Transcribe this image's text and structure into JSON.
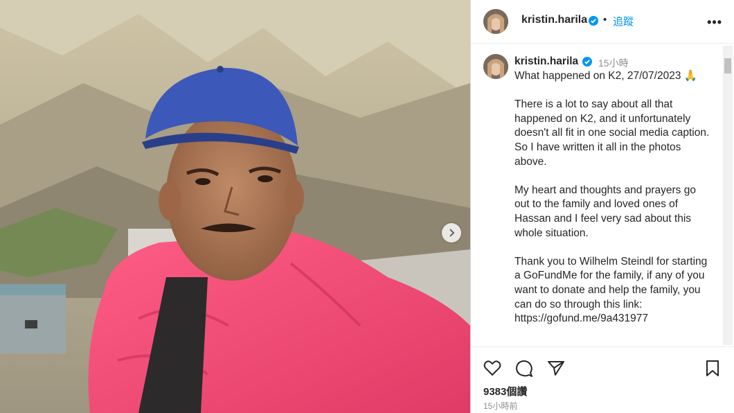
{
  "post": {
    "author": "kristin.harila",
    "follow_label": "追蹤",
    "bullet": "•",
    "more_label": "•••",
    "caption_author": "kristin.harila",
    "caption_time": "15小時",
    "caption_text": "What happened on K2, 27/07/2023 🙏\n\nThere is a lot to say about all that happened on K2, and it unfortunately doesn't all fit in one social media caption. So I have written it all in the photos above.\n\nMy heart and thoughts and prayers go out to the family and loved ones of Hassan and I feel very sad about this whole situation.\n\nThank you to Wilhelm Steindl for starting a GoFundMe for the family, if any of you want to donate and help the family, you can do so through this link:\nhttps://gofund.me/9a431977",
    "likes": "9383個讚",
    "posted_ago": "15小時前"
  },
  "icons": {
    "verified": "verified-badge-icon",
    "more": "more-options-icon",
    "like": "heart-icon",
    "comment": "comment-icon",
    "share": "share-icon",
    "save": "bookmark-icon",
    "next": "chevron-right-icon"
  },
  "colors": {
    "accent": "#0095f6",
    "text": "#262626",
    "muted": "#8e8e8e"
  }
}
